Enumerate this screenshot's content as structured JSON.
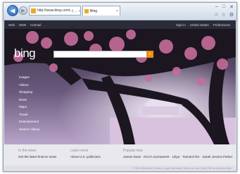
{
  "browser": {
    "address": "http://www.bing.com/",
    "address_tools": "• § → ×",
    "tab_title": "Bing",
    "tab_close": "×",
    "back_glyph": "◀",
    "forward_glyph": "▶",
    "window_controls": [
      "–",
      "□",
      "✕"
    ],
    "toolbar_icons": [
      "⌂",
      "☆",
      "⚙"
    ]
  },
  "bing_header": {
    "left_links": [
      "Web",
      "MSN",
      "Hotmail"
    ],
    "right_links": [
      "Sign in",
      "United States",
      "Preferences"
    ]
  },
  "logo": "bing",
  "search": {
    "value": "",
    "button_glyph": "⌕"
  },
  "sidenav": [
    "Images",
    "Videos",
    "Shopping",
    "News",
    "Maps",
    "Travel",
    "Entertainment",
    "Search History"
  ],
  "footer": {
    "in_the_news": {
      "heading": "In the news",
      "text": "Get the latest finance news"
    },
    "learn_more": {
      "heading": "Learn more",
      "text": "About U.S. politicians"
    },
    "popular_now": {
      "heading": "Popular now",
      "text": "James Dean · NCAA tournament · Libya · Tsunami fire · Sarah Jessica Parker"
    },
    "copyright": "© 2011 Microsoft | Privacy | Legal | Advertise | About our ads | Help | Tell us what you think"
  },
  "colors": {
    "accent": "#f08c1a",
    "page_bg": "#1d1c2c",
    "footer_bg": "#e9e9ed"
  }
}
